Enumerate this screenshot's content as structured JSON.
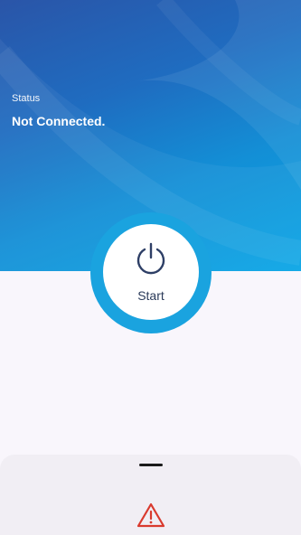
{
  "status": {
    "label": "Status",
    "value": "Not Connected."
  },
  "main": {
    "start_label": "Start",
    "power_icon": "power-icon",
    "ring_color": "#1aa3df"
  },
  "bottom_sheet": {
    "warning_icon": "warning-icon",
    "warning_color": "#d93a2e"
  },
  "colors": {
    "header_start": "#2a55a8",
    "header_end": "#0aa6e6",
    "background": "#f9f6fc"
  }
}
